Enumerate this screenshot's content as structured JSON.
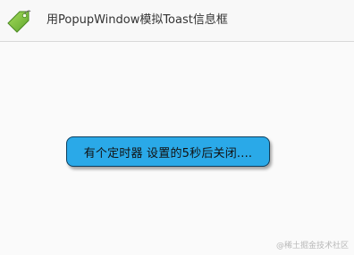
{
  "action_bar": {
    "title": "用PopupWindow模拟Toast信息框",
    "icon": "green-tag-icon"
  },
  "toast": {
    "text": "有个定时器 设置的5秒后关闭...."
  },
  "watermark": {
    "text": "@稀土掘金技术社区"
  },
  "colors": {
    "toast_background": "#2aa9e8",
    "toast_border": "#0d3f5e",
    "icon_green": "#7cc242"
  }
}
